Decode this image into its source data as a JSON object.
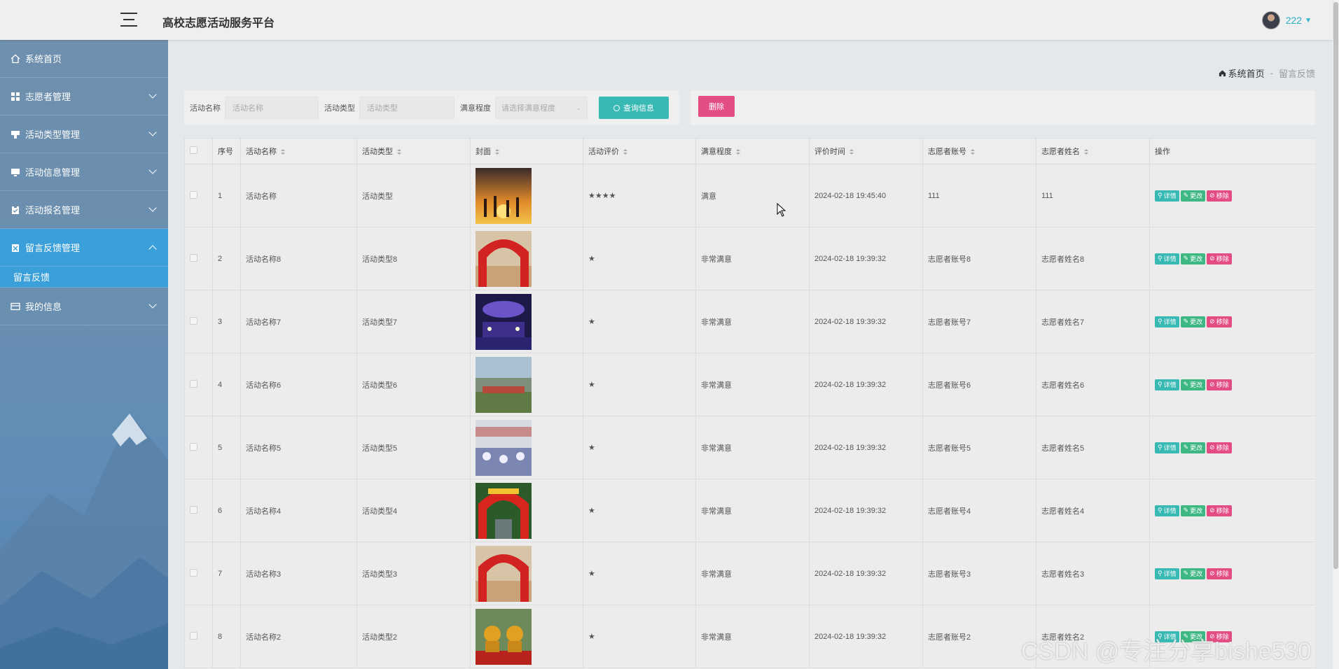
{
  "header": {
    "title": "高校志愿活动服务平台",
    "username": "222"
  },
  "sidebar": {
    "items": [
      {
        "label": "系统首页",
        "icon": "home-icon"
      },
      {
        "label": "志愿者管理",
        "icon": "grid-icon"
      },
      {
        "label": "活动类型管理",
        "icon": "tag-icon"
      },
      {
        "label": "活动信息管理",
        "icon": "monitor-icon"
      },
      {
        "label": "活动报名管理",
        "icon": "clipboard-icon"
      },
      {
        "label": "留言反馈管理",
        "icon": "feedback-icon"
      },
      {
        "label": "我的信息",
        "icon": "card-icon"
      }
    ],
    "submenu": {
      "label": "留言反馈"
    }
  },
  "breadcrumb": {
    "home": "系统首页",
    "separator": "-",
    "current": "留言反馈"
  },
  "search": {
    "name_label": "活动名称",
    "name_placeholder": "活动名称",
    "type_label": "活动类型",
    "type_placeholder": "活动类型",
    "satisfaction_label": "满意程度",
    "satisfaction_placeholder": "请选择满意程度",
    "button": "查询信息"
  },
  "actions": {
    "delete": "删除"
  },
  "table": {
    "columns": [
      "序号",
      "活动名称",
      "活动类型",
      "封面",
      "活动评价",
      "满意程度",
      "评价时间",
      "志愿者账号",
      "志愿者姓名",
      "操作"
    ],
    "op_labels": {
      "detail": "详情",
      "edit": "更改",
      "remove": "移除"
    },
    "rows": [
      {
        "no": "1",
        "name": "活动名称",
        "type": "活动类型",
        "rating": "★★★★",
        "satisfaction": "满意",
        "time": "2024-02-18 19:45:40",
        "account": "111",
        "volunteer": "111",
        "cover": "sunset"
      },
      {
        "no": "2",
        "name": "活动名称8",
        "type": "活动类型8",
        "rating": "★",
        "satisfaction": "非常满意",
        "time": "2024-02-18 19:39:32",
        "account": "志愿者账号8",
        "volunteer": "志愿者姓名8",
        "cover": "red-arch"
      },
      {
        "no": "3",
        "name": "活动名称7",
        "type": "活动类型7",
        "rating": "★",
        "satisfaction": "非常满意",
        "time": "2024-02-18 19:39:32",
        "account": "志愿者账号7",
        "volunteer": "志愿者姓名7",
        "cover": "stage"
      },
      {
        "no": "4",
        "name": "活动名称6",
        "type": "活动类型6",
        "rating": "★",
        "satisfaction": "非常满意",
        "time": "2024-02-18 19:39:32",
        "account": "志愿者账号6",
        "volunteer": "志愿者姓名6",
        "cover": "outdoor"
      },
      {
        "no": "5",
        "name": "活动名称5",
        "type": "活动类型5",
        "rating": "★",
        "satisfaction": "非常满意",
        "time": "2024-02-18 19:39:32",
        "account": "志愿者账号5",
        "volunteer": "志愿者姓名5",
        "cover": "banquet"
      },
      {
        "no": "6",
        "name": "活动名称4",
        "type": "活动类型4",
        "rating": "★",
        "satisfaction": "非常满意",
        "time": "2024-02-18 19:39:32",
        "account": "志愿者账号4",
        "volunteer": "志愿者姓名4",
        "cover": "balloon-arch"
      },
      {
        "no": "7",
        "name": "活动名称3",
        "type": "活动类型3",
        "rating": "★",
        "satisfaction": "非常满意",
        "time": "2024-02-18 19:39:32",
        "account": "志愿者账号3",
        "volunteer": "志愿者姓名3",
        "cover": "red-arch"
      },
      {
        "no": "8",
        "name": "活动名称2",
        "type": "活动类型2",
        "rating": "★",
        "satisfaction": "非常满意",
        "time": "2024-02-18 19:39:32",
        "account": "志愿者账号2",
        "volunteer": "志愿者姓名2",
        "cover": "lions"
      }
    ]
  },
  "watermark": "CSDN @专注分享bishe530",
  "colors": {
    "accent_teal": "#38b9b4",
    "edit_green": "#3eb883",
    "danger_pink": "#e44d83",
    "sidebar_active": "#3ba0da"
  }
}
